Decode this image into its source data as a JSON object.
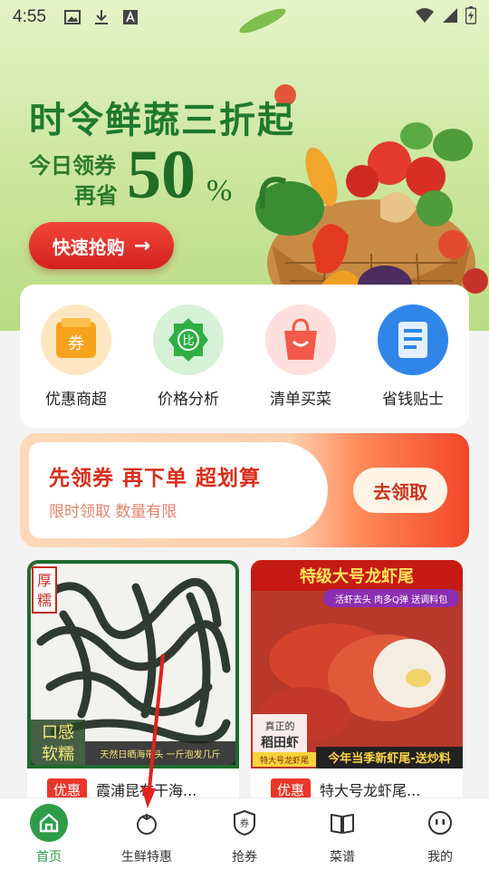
{
  "status_bar": {
    "time": "4:55"
  },
  "banner": {
    "title": "时令鲜蔬三折起",
    "subtitle_line1": "今日领券",
    "subtitle_line2": "再省",
    "percent": "50",
    "percent_sign": "%",
    "cta_label": "快速抢购",
    "cta_arrow": "→"
  },
  "categories": [
    {
      "label": "优惠商超",
      "icon": "coupon-ticket-icon",
      "color": "#f7a01e",
      "glyph": "券"
    },
    {
      "label": "价格分析",
      "icon": "price-badge-icon",
      "color": "#2fae43",
      "glyph": "比"
    },
    {
      "label": "清单买菜",
      "icon": "shopping-bag-icon",
      "color": "#f25a4a",
      "glyph": ""
    },
    {
      "label": "省钱贴士",
      "icon": "tips-book-icon",
      "color": "#2f86e8",
      "glyph": ""
    }
  ],
  "coupon_banner": {
    "title": "先领券 再下单 超划算",
    "subtitle": "限时领取 数量有限",
    "button_label": "去领取"
  },
  "products": [
    {
      "badge": "优惠",
      "name": "霞浦昆布干海...",
      "overlay_tag": "厚糯",
      "overlay_big": "口感软糯",
      "overlay_strip": "天然日晒海带头 一斤泡发几斤 煲汤 加料更美味"
    },
    {
      "badge": "优惠",
      "name": "特大号龙虾尾...",
      "overlay_title": "特级大号龙虾尾",
      "overlay_tag": "活虾去头 肉多Q弹 送调料包",
      "overlay_origin": "真正的稻田虾",
      "overlay_label": "特大号龙虾尾",
      "overlay_strip": "今年当季新虾尾-送炒料"
    }
  ],
  "bottom_nav": [
    {
      "label": "首页",
      "icon": "home-icon",
      "active": true
    },
    {
      "label": "生鲜特惠",
      "icon": "tomato-icon",
      "active": false
    },
    {
      "label": "抢券",
      "icon": "coupon-shield-icon",
      "glyph": "券",
      "active": false
    },
    {
      "label": "菜谱",
      "icon": "recipe-book-icon",
      "active": false
    },
    {
      "label": "我的",
      "icon": "profile-face-icon",
      "active": false
    }
  ],
  "colors": {
    "accent_green": "#2f9c4a",
    "accent_red": "#e8372a",
    "banner_green": "#1f7a2e"
  }
}
